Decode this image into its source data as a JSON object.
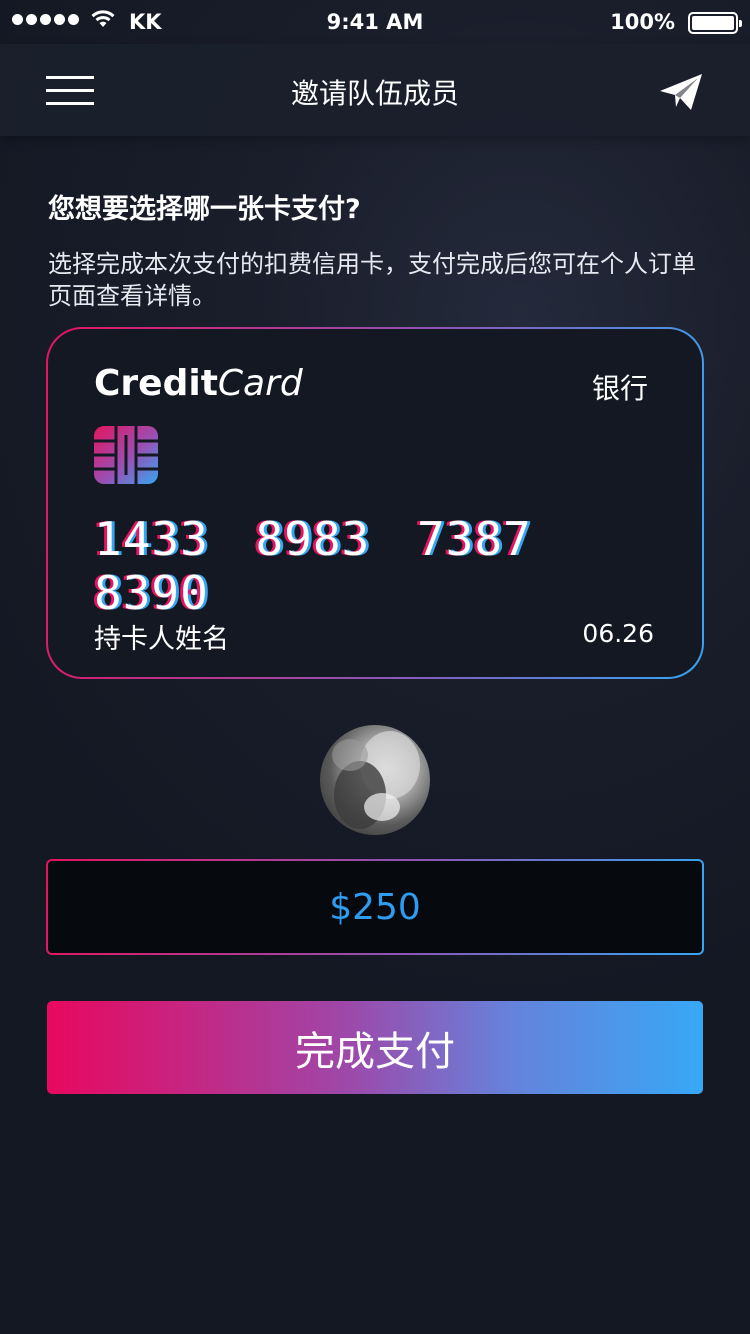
{
  "status_bar": {
    "carrier": "KK",
    "time": "9:41 AM",
    "battery": "100%"
  },
  "nav": {
    "title": "邀请队伍成员"
  },
  "question": "您想要选择哪一张卡支付?",
  "description": "选择完成本次支付的扣费信用卡，支付完成后您可在个人订单页面查看详情。",
  "card": {
    "logo_bold": "Credit",
    "logo_light": "Card",
    "bank": "银行",
    "number": "1433 8983 7387 8390",
    "holder": "持卡人姓名",
    "expiry": "06.26"
  },
  "amount": "$250",
  "pay_button": "完成支付",
  "colors": {
    "gradient_start": "#e5145f",
    "gradient_end": "#35a6f1",
    "amount_text": "#2f9cf0"
  },
  "icons": {
    "menu": "hamburger-icon",
    "send": "paper-plane-icon",
    "chip": "card-chip-icon"
  }
}
